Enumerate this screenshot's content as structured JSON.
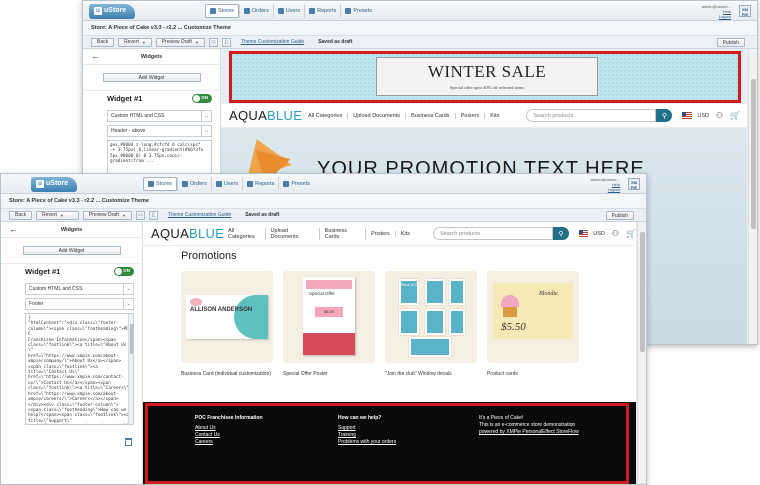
{
  "app": {
    "logo": "uStore",
    "nav": [
      "Stores",
      "Orders",
      "Users",
      "Reports",
      "Presets"
    ],
    "user_line1": "admin@ustore...",
    "user_line2": "Help",
    "user_line3": "Logout",
    "xmpie": "XM PIE"
  },
  "page_title": "Store: A Piece of Cake v3.3 - r2.2 ... Customize Theme",
  "toolbar": {
    "back": "Back",
    "revert": "Revert",
    "preview": "Preview Draft",
    "guide": "Theme Customization Guide",
    "status": "Saved as draft",
    "publish": "Publish"
  },
  "panel": {
    "title": "Widgets",
    "add_widget": "Add Widget",
    "widget_name": "Widget #1",
    "toggle": "ON",
    "type": "Custom HTML and CSS",
    "back_position": "Header - above",
    "front_position": "Footer",
    "back_code": "gex,#0004 z-long,#cfcfd 0 calc(spc*\n-+ 3.75px) 0,linear-gradient(#b6f3fa\n5px,#0000 0) 0 3.75px,conic-\ngradient(from ...",
    "front_code": "{\n\"htmlContent\":\"<div class=\\\"footer-\ncolumn\\\"><span class=\\\"footheading\\\">POC\nFranchisee Information</span><span\nclass=\\\"footlink\\\"><a title=\\\"About Us\\\"\nhref=\\\"https://www.xmpie.com/about-\nxmpie/company/\\\">About Us</a></span>\n<span class=\\\"footlink\\\"><a\ntitle=\\\"Contact Us\\\"\nhref=\\\"https://www.xmpie.com/contact-\nus/\\\">Contact Us</a></span><span\nclass=\\\"footlink\\\"><a title=\\\"Careers\\\"\nhref=\\\"https://www.xmpie.com/about-\nxmpie/careers/\\\">Careers</a></span>\n</div><div class=\\\"footer-column\\\">\n<span class=\\\"footheading\\\">How can we\nhelp?</span><span class=\\\"footlink\\\"><a\ntitle=\\\"Support\\\"\nhref=\\\"https://www.xmpie.com/support/\\\"\n>Support</a></span><span\nclass=\\\"footlink\\\"><a title=\\\"Training\\\"\nhref=\\\"https://www.xmpie.com/training/"
  },
  "preview": {
    "banner_title": "WINTER SALE",
    "banner_sub": "Special offer upto 40% off selected items",
    "brand_a": "AQUA",
    "brand_b": "BLUE",
    "nav": [
      "All Categories",
      "Upload Documents",
      "Business Cards",
      "Posters",
      "Kits"
    ],
    "search_placeholder": "Search products",
    "currency": "USD",
    "hero_text": "YOUR PROMOTION TEXT HERE",
    "promotions_title": "Promotions",
    "cards": [
      {
        "label": "Business Card (individual customization)",
        "name_text": "ALLISON ANDERSON"
      },
      {
        "label": "Special Offer Poster",
        "name_text": "Special Offer",
        "price": "$5.00"
      },
      {
        "label": "\"Join the club\" Window decals",
        "name_text": "Piece of Cake"
      },
      {
        "label": "Product cards",
        "name_text": "Blondie",
        "price": "$5.50"
      }
    ],
    "footer": {
      "col1_title": "POC Franchisee Information",
      "col1_links": [
        "About Us",
        "Contact Us",
        "Careers"
      ],
      "col2_title": "How can we help?",
      "col2_links": [
        "Support",
        "Training",
        "Problems with your orders"
      ],
      "col3_title": "It's a Piece of Cake!",
      "col3_text": "This is an e-commerce store demonstration",
      "col3_link": "powered by XMPie PersonalEffect StoreFlow"
    }
  },
  "colors": {
    "highlight": "#d01c1c",
    "brand_accent": "#2b9cc4",
    "toggle_on": "#2e8b3c",
    "search_button": "#1e6f88"
  }
}
